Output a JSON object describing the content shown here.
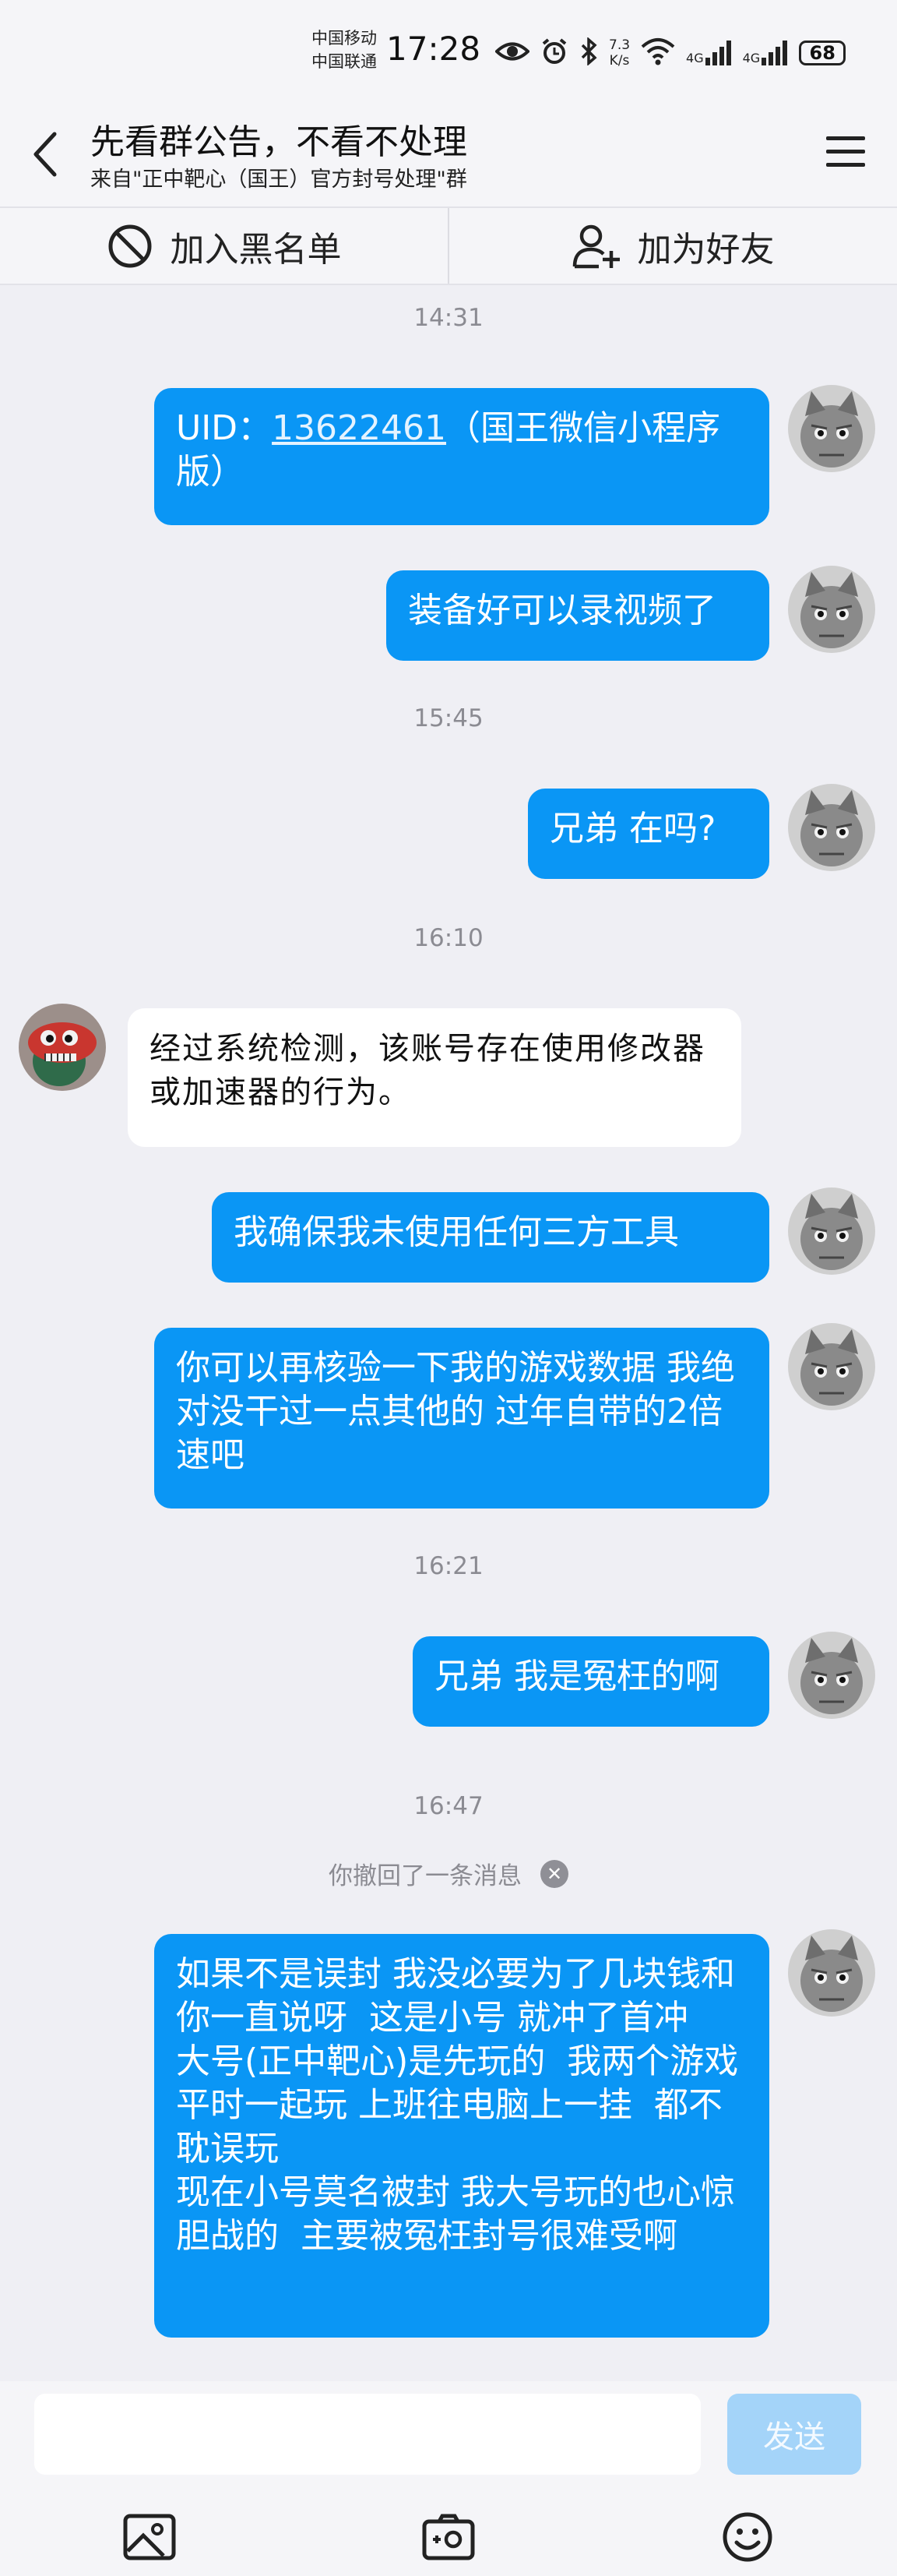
{
  "status_bar": {
    "carrier_1": "中国移动",
    "carrier_2": "中国联通",
    "time": "17:28",
    "net_speed_value": "7.3",
    "net_speed_unit": "K/s",
    "signal_1": "4G",
    "signal_2": "4G",
    "battery": "68",
    "icons": [
      "eye-icon",
      "alarm-icon",
      "bluetooth-icon",
      "wifi-icon",
      "signal-icon",
      "battery-icon"
    ]
  },
  "header": {
    "title": "先看群公告，不看不处理",
    "subtitle": "来自\"正中靶心（国王）官方封号处理\"群"
  },
  "actions": {
    "blacklist": "加入黑名单",
    "add_friend": "加为好友"
  },
  "messages": [
    {
      "type": "timestamp",
      "text": "14:31"
    },
    {
      "type": "out",
      "prefix": "UID：",
      "link": "13622461",
      "suffix": "（国王微信小程序版）"
    },
    {
      "type": "out",
      "text": "装备好可以录视频了"
    },
    {
      "type": "timestamp",
      "text": "15:45"
    },
    {
      "type": "out",
      "text": "兄弟 在吗?"
    },
    {
      "type": "timestamp",
      "text": "16:10"
    },
    {
      "type": "in",
      "text": "经过系统检测，该账号存在使用修改器或加速器的行为。"
    },
    {
      "type": "out",
      "text": "我确保我未使用任何三方工具"
    },
    {
      "type": "out",
      "text": "你可以再核验一下我的游戏数据 我绝对没干过一点其他的  过年自带的2倍速吧"
    },
    {
      "type": "timestamp",
      "text": "16:21"
    },
    {
      "type": "out",
      "text": "兄弟 我是冤枉的啊"
    },
    {
      "type": "timestamp",
      "text": "16:47"
    },
    {
      "type": "recall",
      "text": "你撤回了一条消息"
    },
    {
      "type": "out",
      "text": "如果不是误封 我没必要为了几块钱和你一直说呀  这是小号 就冲了首冲   大号(正中靶心)是先玩的  我两个游戏平时一起玩 上班往电脑上一挂  都不耽误玩\n现在小号莫名被封 我大号玩的也心惊胆战的  主要被冤枉封号很难受啊"
    }
  ],
  "input": {
    "value": "",
    "placeholder": "",
    "send_label": "发送"
  },
  "bottom_toolbar": [
    "image-icon",
    "camera-icon",
    "emoji-icon"
  ],
  "colors": {
    "accent": "#0a96f5",
    "background": "#efeff4",
    "send_disabled": "#a4d4f9"
  }
}
